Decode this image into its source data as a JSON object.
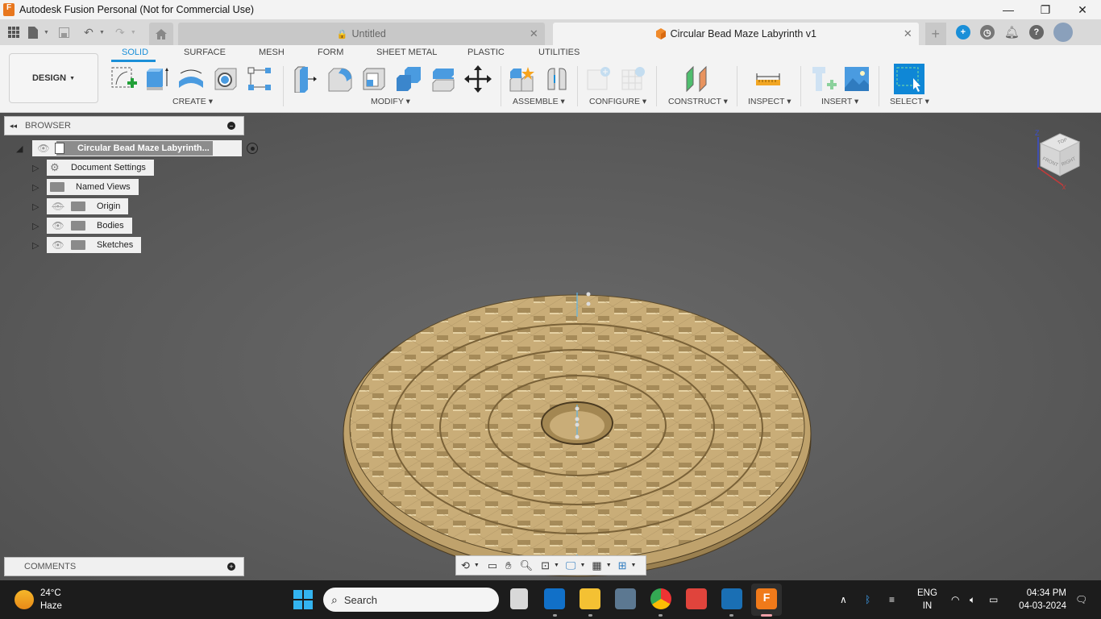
{
  "window": {
    "title": "Autodesk Fusion Personal (Not for Commercial Use)",
    "app_icon_letter": "F",
    "controls": {
      "minimize": "—",
      "restore": "❐",
      "close": "✕"
    }
  },
  "tabs": {
    "home_icon": "home-icon",
    "items": [
      {
        "label": "Untitled",
        "locked": true,
        "active": false
      },
      {
        "label": "Circular Bead Maze Labyrinth v1",
        "locked": false,
        "active": true
      }
    ],
    "new_tab_label": "+"
  },
  "toolbar": {
    "workspace_label": "DESIGN",
    "tabs": [
      "SOLID",
      "SURFACE",
      "MESH",
      "FORM",
      "SHEET METAL",
      "PLASTIC",
      "UTILITIES"
    ],
    "active_tab": "SOLID",
    "groups": [
      {
        "label": "CREATE",
        "tools": [
          "create-sketch",
          "extrude",
          "revolve",
          "hole",
          "pattern"
        ]
      },
      {
        "label": "MODIFY",
        "tools": [
          "press-pull",
          "fillet",
          "shell",
          "combine",
          "split-body",
          "move-copy"
        ]
      },
      {
        "label": "ASSEMBLE",
        "tools": [
          "new-component",
          "joint"
        ]
      },
      {
        "label": "CONFIGURE",
        "tools": [
          "configure-table",
          "configure-grid"
        ]
      },
      {
        "label": "CONSTRUCT",
        "tools": [
          "offset-plane"
        ]
      },
      {
        "label": "INSPECT",
        "tools": [
          "measure"
        ]
      },
      {
        "label": "INSERT",
        "tools": [
          "insert-mcmaster",
          "insert-canvas"
        ]
      },
      {
        "label": "SELECT",
        "tools": [
          "window-select"
        ]
      }
    ]
  },
  "browser": {
    "title": "BROWSER",
    "root": "Circular Bead Maze Labyrinth...",
    "items": [
      {
        "label": "Document Settings",
        "icon": "gear-icon",
        "visibility": "none"
      },
      {
        "label": "Named Views",
        "icon": "folder-icon",
        "visibility": "none"
      },
      {
        "label": "Origin",
        "icon": "folder-icon",
        "visibility": "hidden"
      },
      {
        "label": "Bodies",
        "icon": "folder-icon",
        "visibility": "visible"
      },
      {
        "label": "Sketches",
        "icon": "folder-icon",
        "visibility": "visible"
      }
    ]
  },
  "viewcube": {
    "top": "TOP",
    "front": "FRONT",
    "right": "RIGHT",
    "axis_z": "Z",
    "axis_x": "X"
  },
  "comments": {
    "title": "COMMENTS"
  },
  "navbar": {
    "tools": [
      "orbit",
      "look-at",
      "pan",
      "zoom",
      "fit",
      "display-settings",
      "grid-settings",
      "viewports"
    ]
  },
  "taskbar": {
    "weather": {
      "temp": "24°C",
      "condition": "Haze"
    },
    "search_placeholder": "Search",
    "apps": [
      "file-manager",
      "outlook",
      "explorer",
      "calculator",
      "chrome",
      "todoist",
      "app-c",
      "fusion"
    ],
    "language": {
      "line1": "ENG",
      "line2": "IN"
    },
    "time": "04:34 PM",
    "date": "04-03-2024"
  }
}
